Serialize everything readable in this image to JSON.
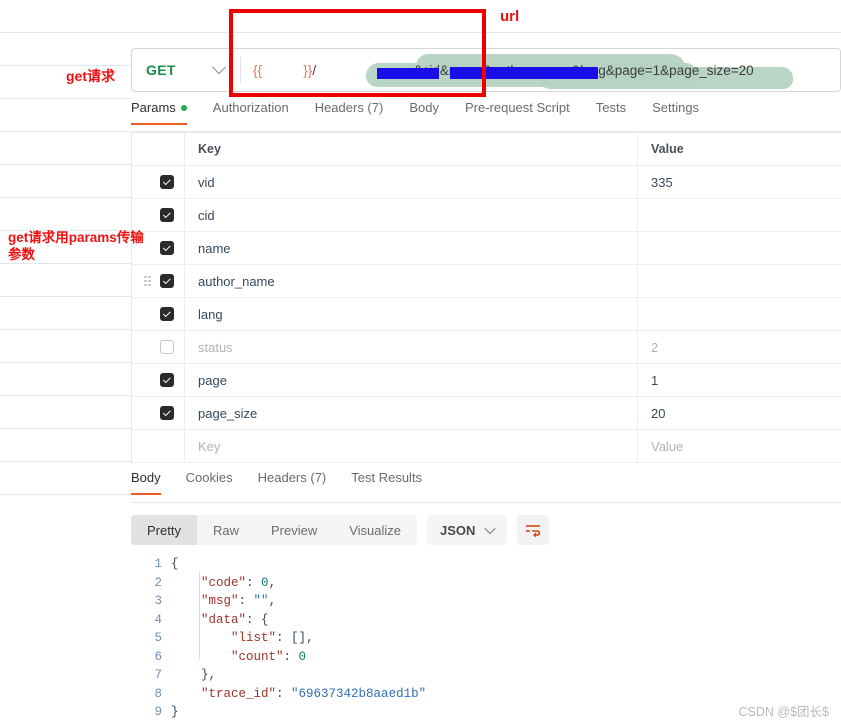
{
  "request": {
    "method": "GET",
    "url_prefix": "{{",
    "url_var_open": "{{",
    "url_var_close": "}}",
    "url_separator": "/",
    "url_visible_tail": "&cid&name&author_name&lang&page=1&page_size=20",
    "tabs": [
      {
        "label": "Params",
        "has_dot": true,
        "active": true
      },
      {
        "label": "Authorization",
        "has_dot": false,
        "active": false
      },
      {
        "label": "Headers (7)",
        "has_dot": false,
        "active": false
      },
      {
        "label": "Body",
        "has_dot": false,
        "active": false
      },
      {
        "label": "Pre-request Script",
        "has_dot": false,
        "active": false
      },
      {
        "label": "Tests",
        "has_dot": false,
        "active": false
      },
      {
        "label": "Settings",
        "has_dot": false,
        "active": false
      }
    ]
  },
  "params_table": {
    "headers": {
      "key": "Key",
      "value": "Value"
    },
    "placeholder": {
      "key": "Key",
      "value": "Value"
    },
    "rows": [
      {
        "checked": true,
        "enabled": true,
        "key": "vid",
        "value": "335",
        "handle": false
      },
      {
        "checked": true,
        "enabled": true,
        "key": "cid",
        "value": "",
        "handle": false
      },
      {
        "checked": true,
        "enabled": true,
        "key": "name",
        "value": "",
        "handle": false
      },
      {
        "checked": true,
        "enabled": true,
        "key": "author_name",
        "value": "",
        "handle": true
      },
      {
        "checked": true,
        "enabled": true,
        "key": "lang",
        "value": "",
        "handle": false
      },
      {
        "checked": false,
        "enabled": false,
        "key": "status",
        "value": "2",
        "handle": false
      },
      {
        "checked": true,
        "enabled": true,
        "key": "page",
        "value": "1",
        "handle": false
      },
      {
        "checked": true,
        "enabled": true,
        "key": "page_size",
        "value": "20",
        "handle": false
      }
    ]
  },
  "response": {
    "tabs": [
      {
        "label": "Body",
        "active": true
      },
      {
        "label": "Cookies",
        "active": false
      },
      {
        "label": "Headers (7)",
        "active": false
      },
      {
        "label": "Test Results",
        "active": false
      }
    ],
    "view_modes": [
      {
        "label": "Pretty",
        "active": true
      },
      {
        "label": "Raw",
        "active": false
      },
      {
        "label": "Preview",
        "active": false
      },
      {
        "label": "Visualize",
        "active": false
      }
    ],
    "format": "JSON",
    "wrap_icon": "wrap-text-icon",
    "line_numbers": [
      "1",
      "2",
      "3",
      "4",
      "5",
      "6",
      "7",
      "8",
      "9"
    ],
    "json": {
      "code": 0,
      "msg": "",
      "data": {
        "list": [],
        "count": 0
      },
      "trace_id": "69637342b8aaed1b"
    },
    "code_lines": [
      {
        "indent": 0,
        "text": "{"
      },
      {
        "indent": 1,
        "key": "\"code\"",
        "val": "0",
        "type": "num",
        "comma": true
      },
      {
        "indent": 1,
        "key": "\"msg\"",
        "val": "\"\"",
        "type": "str",
        "comma": true
      },
      {
        "indent": 1,
        "key": "\"data\"",
        "val": "{",
        "type": "punc",
        "comma": false
      },
      {
        "indent": 2,
        "key": "\"list\"",
        "val": "[]",
        "type": "punc",
        "comma": true
      },
      {
        "indent": 2,
        "key": "\"count\"",
        "val": "0",
        "type": "num",
        "comma": false
      },
      {
        "indent": 1,
        "text": "},"
      },
      {
        "indent": 1,
        "key": "\"trace_id\"",
        "val": "\"69637342b8aaed1b\"",
        "type": "str",
        "comma": false
      },
      {
        "indent": 0,
        "text": "}"
      }
    ]
  },
  "annotations": {
    "get_request": "get请求",
    "params_note": "get请求用params传输\n参数",
    "url_label": "url"
  },
  "watermark": "CSDN @$团长$",
  "colors": {
    "accent_orange": "#ef5b25",
    "method_green": "#1a8c4a",
    "annotation_red": "#ee1111",
    "redaction_blue": "#1a0ee8",
    "marker_green": "#b5d3c2"
  }
}
